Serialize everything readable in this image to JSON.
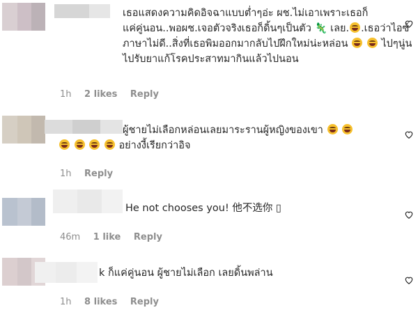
{
  "comments": [
    {
      "lines": [
        "เธอแสดงความคิดอิจฉาแบบต่ำๆอ่ะ ผช.ไม่เอาเพราะเธอก็",
        "แค่คู่นอน..พอผช.เจอตัวจริงเธอก็ดิ้นๆเป็นตัว",
        "ภาษาไม่ดี..สิ่งที่เธอพิมออกมากลับไปฝึกใหม่น่ะหล่อน",
        "ไปรับยาแก้โรคประสาทมากินแล้วไปนอน"
      ],
      "line2_after_emoji": "เลย.",
      "line2_tail": ".เธอว่าไอซ์",
      "line3_tail": "ไปๆนู่น",
      "time": "1h",
      "likes": "2 likes",
      "reply": "Reply"
    },
    {
      "lines": [
        "ผู้ชายไม่เลือกหล่อนเลยมาระรานผู้หญิงของเขา",
        "อย่างงี้เรียกว่าอิจ"
      ],
      "time": "1h",
      "likes": "",
      "reply": "Reply"
    },
    {
      "lines": [
        "He not chooses you! 他不选你 "
      ],
      "glyph": "▯",
      "time": "46m",
      "likes": "1 like",
      "reply": "Reply"
    },
    {
      "lines": [
        "ก็แค่คู่นอน ผู้ชายไม่เลือก เลยดิ้นพล่าน"
      ],
      "prefix": "k",
      "time": "1h",
      "likes": "8 likes",
      "reply": "Reply"
    }
  ],
  "colors": {
    "meta": "#8e8e8e",
    "text": "#262626",
    "lizard": "#3a9a2a"
  },
  "icons": [
    "heart-outline-icon",
    "laughing-face-emoji",
    "lizard-emoji"
  ]
}
